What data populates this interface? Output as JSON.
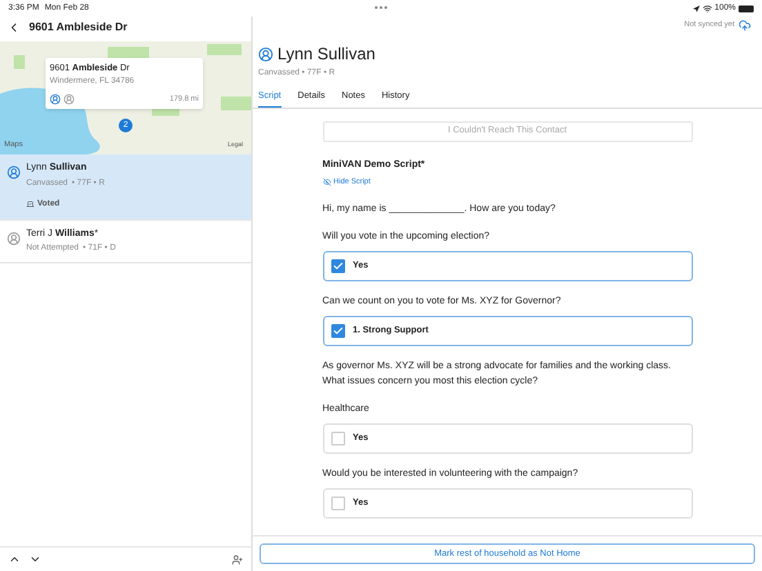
{
  "status_bar": {
    "time": "3:36 PM",
    "date": "Mon Feb 28",
    "battery": "100%"
  },
  "left": {
    "title": "9601 Ambleside Dr",
    "map": {
      "callout_title": "9601 **Ambleside** Dr",
      "callout_subtitle": "Windermere, FL 34786",
      "distance": "179.8 mi",
      "pin": "2",
      "attribution": "Maps",
      "legal": "Legal"
    },
    "people": [
      {
        "name": "Lynn **Sullivan**",
        "status": "Canvassed",
        "details": "• 77F • R",
        "selected": true,
        "badge": "Voted"
      },
      {
        "name": "Terri J **Williams***",
        "status": "Not Attempted",
        "details": "• 71F • D",
        "selected": false
      }
    ]
  },
  "right": {
    "sync": "Not synced yet",
    "contact_name": "Lynn Sullivan",
    "contact_details": "Canvassed • 77F • R",
    "tabs": [
      {
        "label": "Script",
        "selected": true
      },
      {
        "label": "Details",
        "selected": false
      },
      {
        "label": "Notes",
        "selected": false
      },
      {
        "label": "History",
        "selected": false
      }
    ],
    "cant_reach": {
      "label": "I Couldn't Reach This Contact",
      "disabled": true
    },
    "script_title": "MiniVAN Demo Script*",
    "hide_script": "Hide Script",
    "items": [
      {
        "kind": "text",
        "text": "Hi, my name is ______________. How are you today?"
      },
      {
        "kind": "text",
        "text": "Will you vote in the upcoming election?"
      },
      {
        "kind": "option",
        "label": "Yes",
        "checked": true
      },
      {
        "kind": "text",
        "text": "Can we count on you to vote for Ms. XYZ for Governor?"
      },
      {
        "kind": "option",
        "label": "1. Strong Support",
        "checked": true
      },
      {
        "kind": "text",
        "text": "As governor Ms. XYZ will be a strong advocate for families and the working class. What issues concern you most this election cycle?"
      },
      {
        "kind": "text",
        "text": "Healthcare"
      },
      {
        "kind": "option",
        "label": "Yes",
        "checked": false
      },
      {
        "kind": "text",
        "text": "Would you be interested in volunteering with the campaign?"
      },
      {
        "kind": "option",
        "label": "Yes",
        "checked": false
      }
    ],
    "bottom_button": "Mark rest of household as Not Home"
  }
}
